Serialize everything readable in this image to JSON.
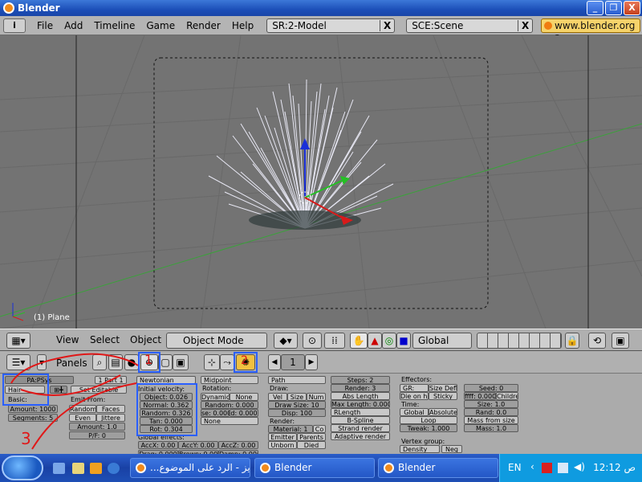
{
  "window": {
    "title": "Blender",
    "min": "_",
    "max": "❐",
    "close": "X"
  },
  "menubar": {
    "info_icon": "i",
    "items": [
      "File",
      "Add",
      "Timeline",
      "Game",
      "Render",
      "Help"
    ],
    "screen": "SR:2-Model",
    "scene": "SCE:Scene",
    "close_x": "X",
    "url": "www.blender.org 2"
  },
  "viewport": {
    "label": "(1) Plane"
  },
  "viewheader": {
    "view": "View",
    "select": "Select",
    "object": "Object",
    "mode": "Object Mode",
    "orientation": "Global"
  },
  "buttons_header": {
    "panels": "Panels",
    "frame": "1",
    "nav_left": "◀",
    "nav_right": "▶"
  },
  "psys": {
    "name": "PA:PSys",
    "type": "Hair",
    "part": "1 Part 1",
    "set_editable": "Set Editable",
    "basic": "Basic:",
    "amount": "Amount: 1000",
    "segments": "Segments: 5",
    "emit_from": "Emit From:",
    "random": "Random",
    "faces": "Faces",
    "even": "Even",
    "jitter": "Jittere",
    "amount2": "Amount: 1.0",
    "pf": "P/F: 0"
  },
  "physics": {
    "type": "Newtonian",
    "initial_velocity": "Initial velocity:",
    "object": "Object: 0.026",
    "normal": "Normal: 0.362",
    "random": "Random: 0.326",
    "tan": "Tan: 0.000",
    "rot": "Rot: 0.304",
    "global_effects": "Global effects:",
    "accx": "AccX: 0.00",
    "accy": "AccY: 0.00",
    "accz": "AccZ: 0.00",
    "drag": "Drag: 0.000",
    "brown": "Brown: 0.00",
    "damp": "Damp: 0.000"
  },
  "rotation": {
    "midpoint": "Midpoint",
    "rotation": "Rotation:",
    "dynamic": "Dynamic",
    "none": "None",
    "random": "Random: 0.000",
    "phase": "se: 0.000",
    "d": "d: 0.000",
    "none2": "None"
  },
  "visualization": {
    "path": "Path",
    "draw": "Draw:",
    "vel": "Vel",
    "size": "Size",
    "num": "Num",
    "draw_size": "Draw Size: 10",
    "disp": "Disp: 100",
    "render": "Render:",
    "material": "Material: 1",
    "co": "Co",
    "emitter": "Emitter",
    "parents": "Parents",
    "unborn": "Unborn",
    "died": "Died"
  },
  "steps": {
    "steps": "Steps: 2",
    "render": "Render: 3",
    "abs_length": "Abs Length",
    "max_length": "Max Length: 0.000",
    "rlength": "RLength",
    "bspline": "B-Spline",
    "strand": "Strand render",
    "adaptive": "Adaptive render"
  },
  "effectors": {
    "title": "Effectors:",
    "gr": "GR:",
    "size_defl": "Size Defl",
    "die_on_hit": "Die on hi",
    "sticky": "Sticky",
    "time": "Time:",
    "global": "Global",
    "absolute": "Absolute",
    "loop": "Loop",
    "tweak": "Tweak: 1.000",
    "vertex_group": "Vertex group:",
    "density": "Density",
    "neg": "Neg"
  },
  "extras": {
    "seed": "Seed: 0",
    "diff": "ffff: 0.000",
    "children": "Childre",
    "size": "Size: 1.0",
    "rand": "Rand: 0.0",
    "mass_from_size": "Mass from size",
    "mass": "Mass: 1.0"
  },
  "annotation": {
    "three": "3",
    "one": "1",
    "two": "2"
  },
  "taskbar": {
    "task1": "...الصنايز - الرد على الموضوع",
    "task2": "Blender",
    "task3": "Blender",
    "lang": "EN",
    "clock": "12:12 ص"
  }
}
